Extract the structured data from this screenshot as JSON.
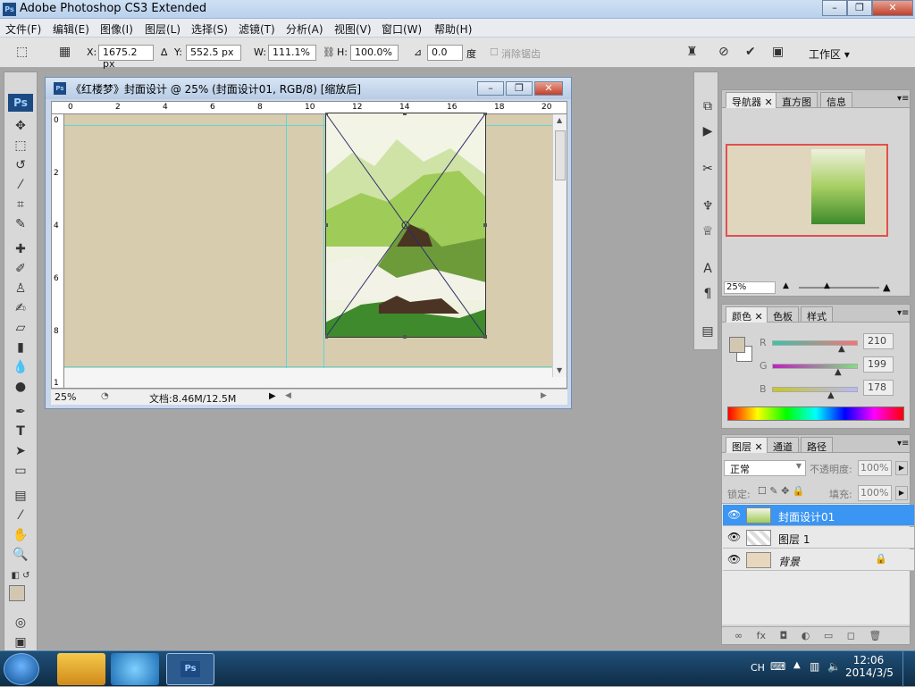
{
  "app_title": "Adobe Photoshop CS3 Extended",
  "menu": [
    {
      "label": "文件(F)"
    },
    {
      "label": "编辑(E)"
    },
    {
      "label": "图像(I)"
    },
    {
      "label": "图层(L)"
    },
    {
      "label": "选择(S)"
    },
    {
      "label": "滤镜(T)"
    },
    {
      "label": "分析(A)"
    },
    {
      "label": "视图(V)"
    },
    {
      "label": "窗口(W)"
    },
    {
      "label": "帮助(H)"
    }
  ],
  "options_bar": {
    "x_label": "X:",
    "x_value": "1675.2 px",
    "y_label": "Y:",
    "y_value": "552.5 px",
    "w_label": "W:",
    "w_value": "111.1%",
    "h_label": "H:",
    "h_value": "100.0%",
    "angle_value": "0.0",
    "angle_unit": "度",
    "antialias_label": "消除锯齿",
    "workspace_label": "工作区 ▾"
  },
  "document": {
    "title": "《红楼梦》封面设计 @ 25% (封面设计01, RGB/8) [缩放后]",
    "zoom": "25%",
    "doc_info": "文档:8.46M/12.5M",
    "ruler_h": [
      "0",
      "2",
      "4",
      "6",
      "8",
      "10",
      "12",
      "14",
      "16",
      "18",
      "20"
    ],
    "ruler_v": [
      "0",
      "2",
      "4",
      "6",
      "8",
      "1"
    ]
  },
  "navigator": {
    "tabs": [
      "导航器",
      "直方图",
      "信息"
    ],
    "zoom": "25%"
  },
  "color_panel": {
    "tabs": [
      "颜色",
      "色板",
      "样式"
    ],
    "channels": [
      {
        "label": "R",
        "value": "210"
      },
      {
        "label": "G",
        "value": "199"
      },
      {
        "label": "B",
        "value": "178"
      }
    ]
  },
  "layers_panel": {
    "tabs": [
      "图层",
      "通道",
      "路径"
    ],
    "blend_mode": "正常",
    "opacity_label": "不透明度:",
    "opacity_value": "100%",
    "lock_label": "锁定:",
    "fill_label": "填充:",
    "fill_value": "100%",
    "layers": [
      {
        "name": "封面设计01",
        "selected": true
      },
      {
        "name": "图层 1",
        "selected": false
      },
      {
        "name": "背景",
        "selected": false
      }
    ]
  },
  "taskbar": {
    "lang": "CH",
    "time": "12:06",
    "date": "2014/3/5"
  }
}
